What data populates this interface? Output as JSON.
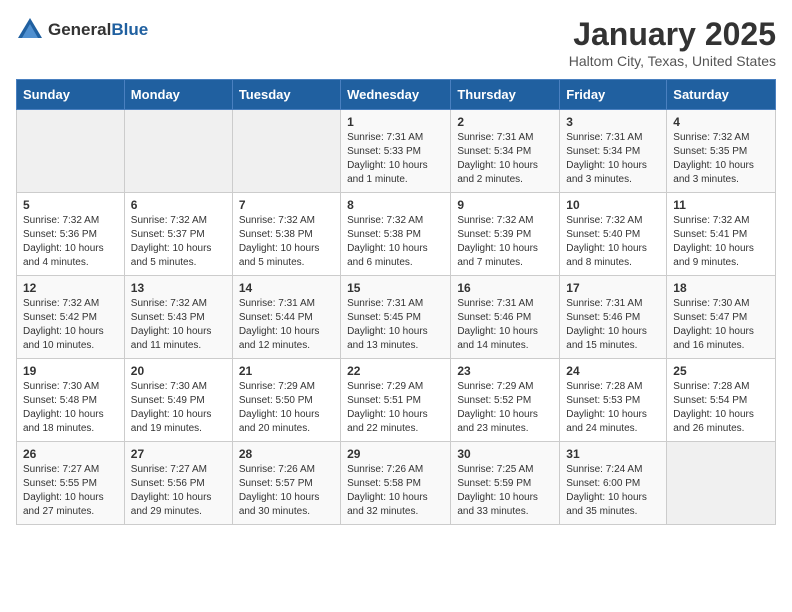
{
  "logo": {
    "text_general": "General",
    "text_blue": "Blue"
  },
  "title": "January 2025",
  "subtitle": "Haltom City, Texas, United States",
  "days_of_week": [
    "Sunday",
    "Monday",
    "Tuesday",
    "Wednesday",
    "Thursday",
    "Friday",
    "Saturday"
  ],
  "weeks": [
    [
      {
        "day": "",
        "info": ""
      },
      {
        "day": "",
        "info": ""
      },
      {
        "day": "",
        "info": ""
      },
      {
        "day": "1",
        "info": "Sunrise: 7:31 AM\nSunset: 5:33 PM\nDaylight: 10 hours\nand 1 minute."
      },
      {
        "day": "2",
        "info": "Sunrise: 7:31 AM\nSunset: 5:34 PM\nDaylight: 10 hours\nand 2 minutes."
      },
      {
        "day": "3",
        "info": "Sunrise: 7:31 AM\nSunset: 5:34 PM\nDaylight: 10 hours\nand 3 minutes."
      },
      {
        "day": "4",
        "info": "Sunrise: 7:32 AM\nSunset: 5:35 PM\nDaylight: 10 hours\nand 3 minutes."
      }
    ],
    [
      {
        "day": "5",
        "info": "Sunrise: 7:32 AM\nSunset: 5:36 PM\nDaylight: 10 hours\nand 4 minutes."
      },
      {
        "day": "6",
        "info": "Sunrise: 7:32 AM\nSunset: 5:37 PM\nDaylight: 10 hours\nand 5 minutes."
      },
      {
        "day": "7",
        "info": "Sunrise: 7:32 AM\nSunset: 5:38 PM\nDaylight: 10 hours\nand 5 minutes."
      },
      {
        "day": "8",
        "info": "Sunrise: 7:32 AM\nSunset: 5:38 PM\nDaylight: 10 hours\nand 6 minutes."
      },
      {
        "day": "9",
        "info": "Sunrise: 7:32 AM\nSunset: 5:39 PM\nDaylight: 10 hours\nand 7 minutes."
      },
      {
        "day": "10",
        "info": "Sunrise: 7:32 AM\nSunset: 5:40 PM\nDaylight: 10 hours\nand 8 minutes."
      },
      {
        "day": "11",
        "info": "Sunrise: 7:32 AM\nSunset: 5:41 PM\nDaylight: 10 hours\nand 9 minutes."
      }
    ],
    [
      {
        "day": "12",
        "info": "Sunrise: 7:32 AM\nSunset: 5:42 PM\nDaylight: 10 hours\nand 10 minutes."
      },
      {
        "day": "13",
        "info": "Sunrise: 7:32 AM\nSunset: 5:43 PM\nDaylight: 10 hours\nand 11 minutes."
      },
      {
        "day": "14",
        "info": "Sunrise: 7:31 AM\nSunset: 5:44 PM\nDaylight: 10 hours\nand 12 minutes."
      },
      {
        "day": "15",
        "info": "Sunrise: 7:31 AM\nSunset: 5:45 PM\nDaylight: 10 hours\nand 13 minutes."
      },
      {
        "day": "16",
        "info": "Sunrise: 7:31 AM\nSunset: 5:46 PM\nDaylight: 10 hours\nand 14 minutes."
      },
      {
        "day": "17",
        "info": "Sunrise: 7:31 AM\nSunset: 5:46 PM\nDaylight: 10 hours\nand 15 minutes."
      },
      {
        "day": "18",
        "info": "Sunrise: 7:30 AM\nSunset: 5:47 PM\nDaylight: 10 hours\nand 16 minutes."
      }
    ],
    [
      {
        "day": "19",
        "info": "Sunrise: 7:30 AM\nSunset: 5:48 PM\nDaylight: 10 hours\nand 18 minutes."
      },
      {
        "day": "20",
        "info": "Sunrise: 7:30 AM\nSunset: 5:49 PM\nDaylight: 10 hours\nand 19 minutes."
      },
      {
        "day": "21",
        "info": "Sunrise: 7:29 AM\nSunset: 5:50 PM\nDaylight: 10 hours\nand 20 minutes."
      },
      {
        "day": "22",
        "info": "Sunrise: 7:29 AM\nSunset: 5:51 PM\nDaylight: 10 hours\nand 22 minutes."
      },
      {
        "day": "23",
        "info": "Sunrise: 7:29 AM\nSunset: 5:52 PM\nDaylight: 10 hours\nand 23 minutes."
      },
      {
        "day": "24",
        "info": "Sunrise: 7:28 AM\nSunset: 5:53 PM\nDaylight: 10 hours\nand 24 minutes."
      },
      {
        "day": "25",
        "info": "Sunrise: 7:28 AM\nSunset: 5:54 PM\nDaylight: 10 hours\nand 26 minutes."
      }
    ],
    [
      {
        "day": "26",
        "info": "Sunrise: 7:27 AM\nSunset: 5:55 PM\nDaylight: 10 hours\nand 27 minutes."
      },
      {
        "day": "27",
        "info": "Sunrise: 7:27 AM\nSunset: 5:56 PM\nDaylight: 10 hours\nand 29 minutes."
      },
      {
        "day": "28",
        "info": "Sunrise: 7:26 AM\nSunset: 5:57 PM\nDaylight: 10 hours\nand 30 minutes."
      },
      {
        "day": "29",
        "info": "Sunrise: 7:26 AM\nSunset: 5:58 PM\nDaylight: 10 hours\nand 32 minutes."
      },
      {
        "day": "30",
        "info": "Sunrise: 7:25 AM\nSunset: 5:59 PM\nDaylight: 10 hours\nand 33 minutes."
      },
      {
        "day": "31",
        "info": "Sunrise: 7:24 AM\nSunset: 6:00 PM\nDaylight: 10 hours\nand 35 minutes."
      },
      {
        "day": "",
        "info": ""
      }
    ]
  ]
}
